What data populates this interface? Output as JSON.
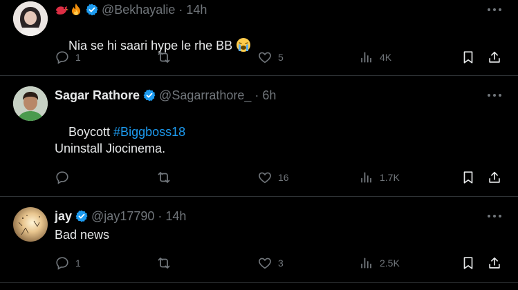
{
  "tweets": [
    {
      "name": "",
      "handle": "@Bekhayalie",
      "time": "14h",
      "dot": "·",
      "text": "Nia se hi saari hype le rhe BB ",
      "emoji": "crying-face",
      "name_emojis": [
        "red-bird-emoji",
        "fire-emoji"
      ],
      "verified": true,
      "replies": "1",
      "retweets": "",
      "likes": "5",
      "views": "4K"
    },
    {
      "name": "Sagar Rathore",
      "handle": "@Sagarrathore_",
      "time": "6h",
      "dot": "·",
      "text_line1_prefix": "Boycott ",
      "hashtag": "#Biggboss18",
      "text_line2": "Uninstall Jiocinema.",
      "verified": true,
      "replies": "",
      "retweets": "",
      "likes": "16",
      "views": "1.7K"
    },
    {
      "name": "jay",
      "handle": "@jay17790",
      "time": "14h",
      "dot": "·",
      "text": "Bad news",
      "verified": true,
      "replies": "1",
      "retweets": "",
      "likes": "3",
      "views": "2.5K"
    }
  ],
  "colors": {
    "background": "#000000",
    "text": "#e7e9ea",
    "muted": "#71767b",
    "accent": "#1d9bf0",
    "divider": "#2f3336"
  },
  "icons": [
    "more-icon",
    "reply-icon",
    "retweet-icon",
    "like-icon",
    "views-icon",
    "bookmark-icon",
    "share-icon",
    "verified-icon"
  ]
}
